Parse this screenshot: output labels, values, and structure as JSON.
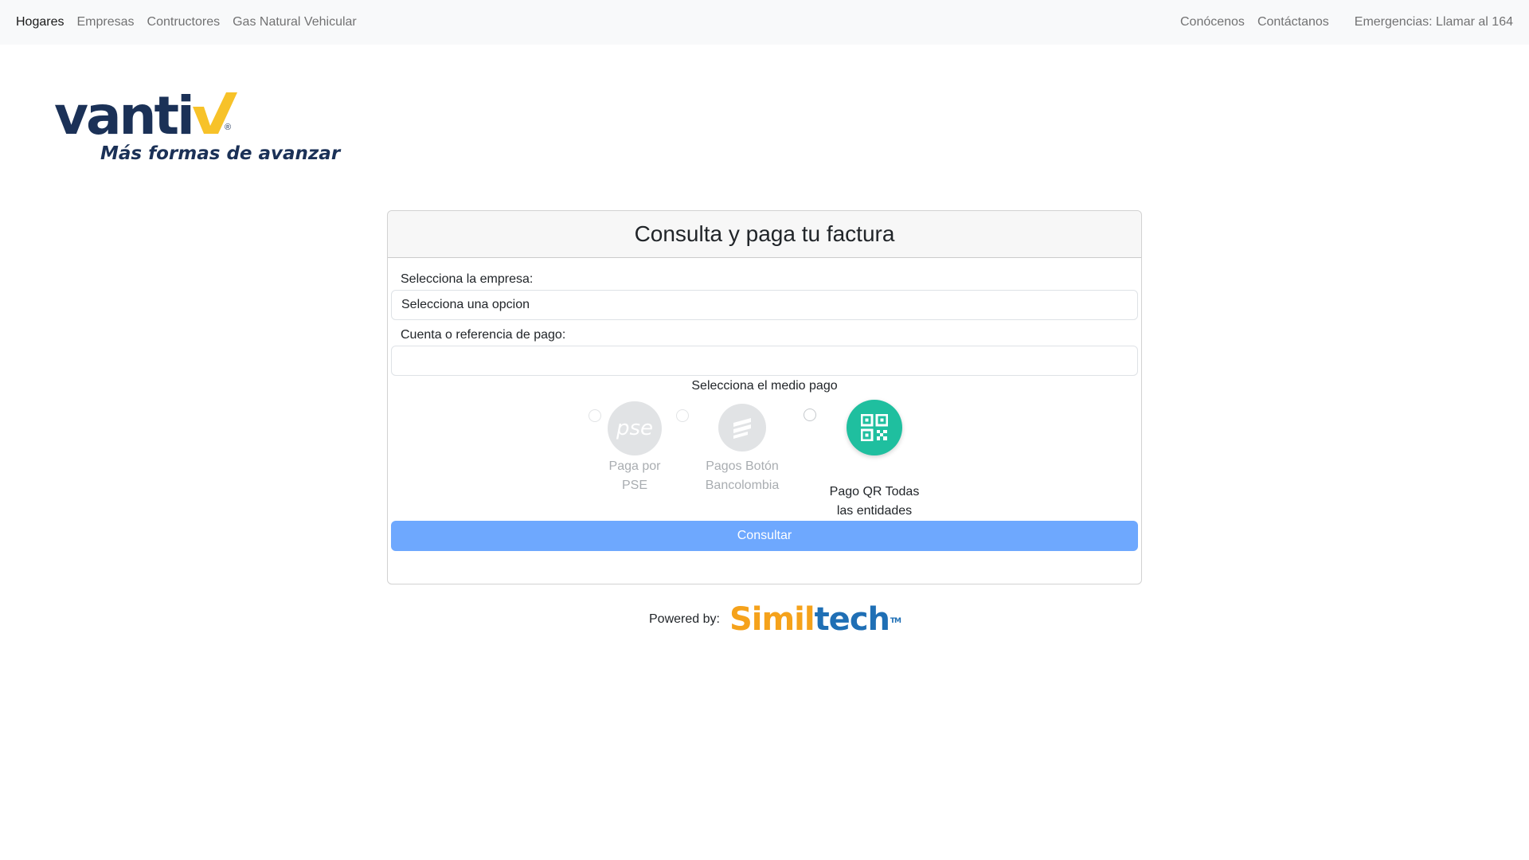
{
  "nav": {
    "left": [
      "Hogares",
      "Empresas",
      "Contructores",
      "Gas Natural Vehicular"
    ],
    "right": [
      "Conócenos",
      "Contáctanos"
    ],
    "emergency": "Emergencias: Llamar al 164"
  },
  "logo": {
    "word": "vanti",
    "tagline": "Más formas de avanzar",
    "reg": "®",
    "colors": {
      "navy": "#1b3157",
      "yellow": "#f7c229"
    }
  },
  "card": {
    "title": "Consulta y paga tu factura",
    "empresa_label": "Selecciona la empresa:",
    "empresa_value": "Selecciona una opcion",
    "referencia_label": "Cuenta o referencia de pago:",
    "referencia_value": "",
    "medio_label": "Selecciona el medio pago",
    "options": [
      {
        "line1": "Paga por",
        "line2": "PSE",
        "icon": "pse-icon",
        "enabled": false
      },
      {
        "line1": "Pagos Botón",
        "line2": "Bancolombia",
        "icon": "bancolombia-icon",
        "enabled": false
      },
      {
        "line1": "Pago QR Todas",
        "line2": "las entidades",
        "icon": "qr-code-icon",
        "enabled": true
      }
    ],
    "button_label": "Consultar",
    "button_color": "#6ea8fe",
    "qr_color": "#1fbf9f"
  },
  "footer": {
    "powered_label": "Powered by:",
    "brand_part1": "Simil",
    "brand_part2": "tech",
    "brand_tm": "TM"
  }
}
